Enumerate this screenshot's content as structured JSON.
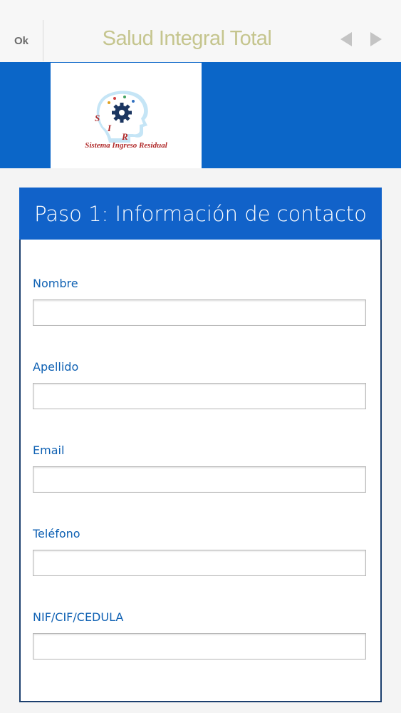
{
  "topbar": {
    "ok_label": "Ok",
    "title": "Salud Integral Total"
  },
  "banner": {
    "logo": {
      "caption": "Sistema Ingreso Residual",
      "letters": [
        "S",
        "I",
        "R"
      ],
      "colors": {
        "head": "#5ab4e6",
        "gear": "#1a3560",
        "text": "#b02a2a"
      }
    }
  },
  "form": {
    "title": "Paso 1: Información de contacto",
    "fields": [
      {
        "label": "Nombre",
        "value": ""
      },
      {
        "label": "Apellido",
        "value": ""
      },
      {
        "label": "Email",
        "value": ""
      },
      {
        "label": "Teléfono",
        "value": ""
      },
      {
        "label": "NIF/CIF/CEDULA",
        "value": ""
      }
    ]
  },
  "colors": {
    "banner": "#0b66c8",
    "card_header": "#1162c9",
    "label": "#0f61b3",
    "title_text": "#c5c58e"
  }
}
